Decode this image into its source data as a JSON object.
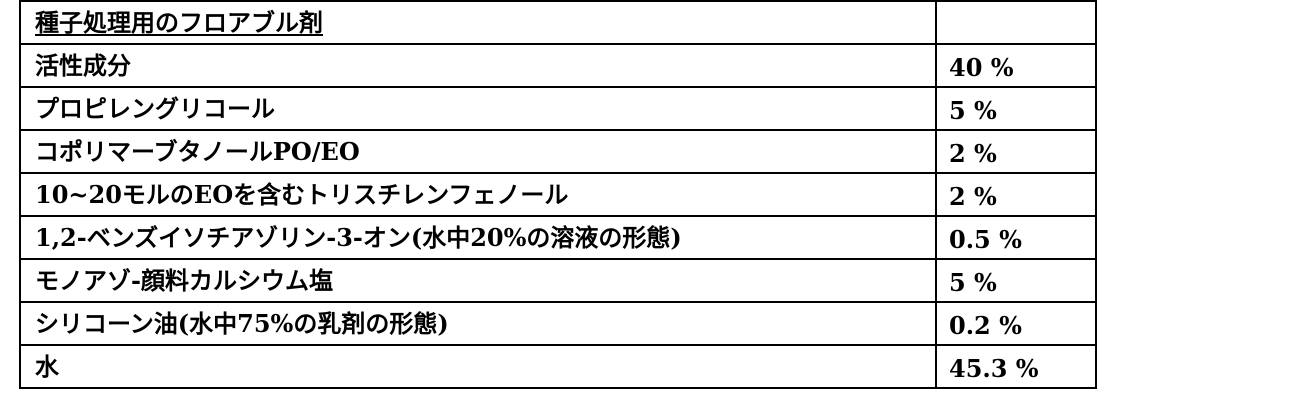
{
  "table": {
    "title": "種子処理用のフロアブル剤",
    "title_value": "",
    "rows": [
      {
        "name": "活性成分",
        "amount": "40 %"
      },
      {
        "name": "プロピレングリコール",
        "amount": "5 %"
      },
      {
        "name": "コポリマーブタノールPO/EO",
        "amount": "2 %"
      },
      {
        "name": "10~20モルのEOを含むトリスチレンフェノール",
        "amount": "2 %"
      },
      {
        "name": "1,2-ベンズイソチアゾリン-3-オン(水中20%の溶液の形態)",
        "amount": "0.5 %"
      },
      {
        "name": "モノアゾ-顔料カルシウム塩",
        "amount": "5 %"
      },
      {
        "name": "シリコーン油(水中75%の乳剤の形態)",
        "amount": "0.2 %"
      },
      {
        "name": "水",
        "amount": "45.3 %"
      }
    ]
  }
}
